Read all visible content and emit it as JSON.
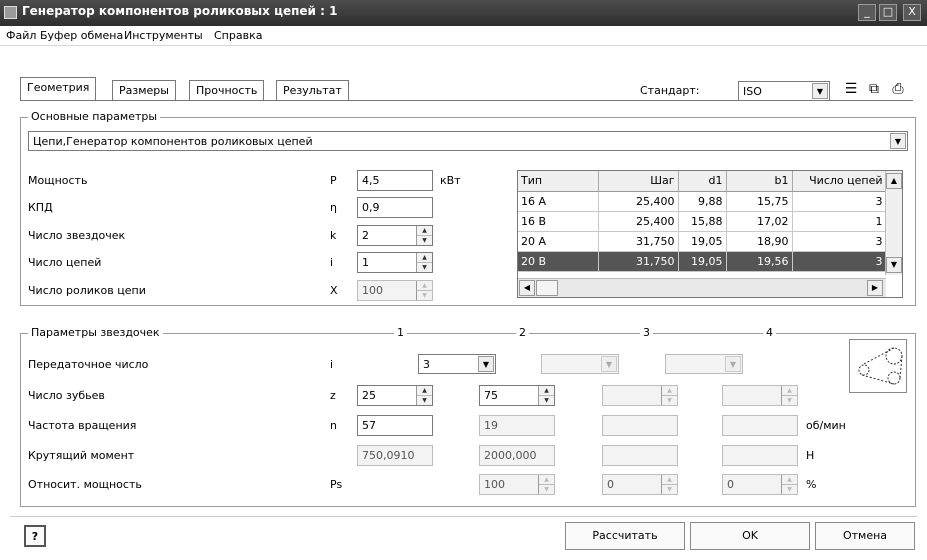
{
  "window": {
    "title": "Генератор компонентов роликовых цепей : 1",
    "minimize": "_",
    "restore": "□",
    "close": "X"
  },
  "menu": [
    "Файл",
    "Буфер обмена",
    "Инструменты",
    "Справка"
  ],
  "tabs": [
    "Геометрия",
    "Размеры",
    "Прочность",
    "Результат"
  ],
  "standard": {
    "label": "Стандарт:",
    "value": "ISO"
  },
  "toolbar_icons": [
    "tree-icon",
    "copy-icon",
    "print-icon"
  ],
  "basic": {
    "title": "Основные параметры",
    "chain_type": "Цепи,Генератор компонентов роликовых цепей",
    "fields": [
      {
        "label": "Мощность",
        "symbol": "P",
        "value": "4,5",
        "unit": "кВт"
      },
      {
        "label": "КПД",
        "symbol": "η",
        "value": "0,9",
        "unit": ""
      },
      {
        "label": "Число звездочек",
        "symbol": "k",
        "value": "2",
        "unit": ""
      },
      {
        "label": "Число цепей",
        "symbol": "i",
        "value": "1",
        "unit": ""
      },
      {
        "label": "Число роликов цепи",
        "symbol": "X",
        "value": "100",
        "unit": ""
      }
    ]
  },
  "chain_table": {
    "columns": [
      "Тип",
      "Шаг",
      "d1",
      "b1",
      "Число цепей"
    ],
    "rows": [
      [
        "16 A",
        "25,400",
        "9,88",
        "15,75",
        "3"
      ],
      [
        "16 B",
        "25,400",
        "15,88",
        "17,02",
        "1"
      ],
      [
        "20 A",
        "31,750",
        "19,05",
        "18,90",
        "3"
      ],
      [
        "20 B",
        "31,750",
        "19,05",
        "19,56",
        "3"
      ]
    ],
    "selected_row": 3
  },
  "sprockets": {
    "title": "Параметры звездочек",
    "columns": [
      "1",
      "2",
      "3",
      "4"
    ],
    "rows": [
      {
        "label": "Передаточное число",
        "symbol": "i",
        "values": [
          "3",
          "",
          "",
          ""
        ],
        "unit": ""
      },
      {
        "label": "Число зубьев",
        "symbol": "z",
        "values": [
          "25",
          "75",
          "",
          ""
        ],
        "unit": ""
      },
      {
        "label": "Частота вращения",
        "symbol": "n",
        "values": [
          "57",
          "19",
          "",
          ""
        ],
        "unit": "об/мин"
      },
      {
        "label": "Крутящий момент",
        "symbol": "",
        "values": [
          "750,0910",
          "2000,000",
          "",
          ""
        ],
        "unit": "Н"
      },
      {
        "label": "Относит. мощность",
        "symbol": "Ps",
        "values": [
          "",
          "100",
          "0",
          "0"
        ],
        "unit": "%"
      }
    ]
  },
  "buttons": {
    "help": "?",
    "calculate": "Рассчитать",
    "ok": "OK",
    "cancel": "Отмена"
  }
}
